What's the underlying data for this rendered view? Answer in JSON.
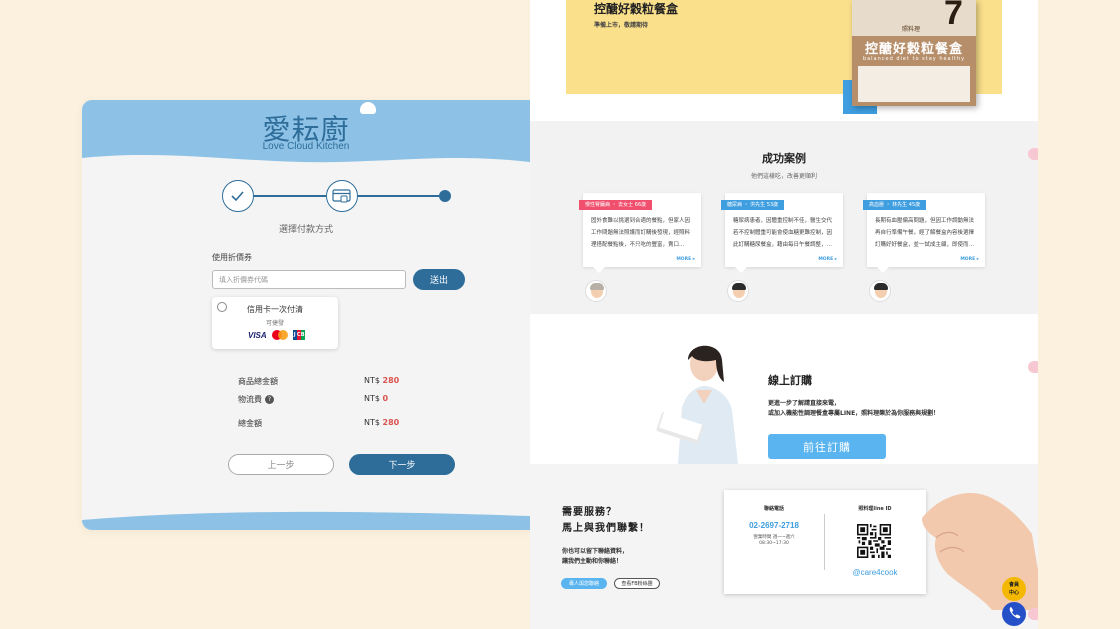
{
  "checkout": {
    "logo_cn": "愛耘廚",
    "logo_en": "Love Cloud Kitchen",
    "step_caption": "選擇付款方式",
    "coupon": {
      "label": "使用折價券",
      "placeholder": "填入折價券代碼",
      "submit": "送出"
    },
    "payment_option": {
      "title": "信用卡一次付清",
      "subtitle": "可捷發",
      "brands": [
        "VISA",
        "MasterCard",
        "JCB"
      ]
    },
    "summary": [
      {
        "label": "商品總金額",
        "currency": "NT$",
        "value": "280"
      },
      {
        "label": "物流費",
        "currency": "NT$",
        "value": "0"
      },
      {
        "label": "總金額",
        "currency": "NT$",
        "value": "280"
      }
    ],
    "prev_button": "上一步",
    "next_button": "下一步",
    "colors": {
      "primary": "#2e6d99",
      "wave": "#8dc2e6",
      "price": "#d9534f"
    }
  },
  "landing": {
    "promo": {
      "title": "控醣好穀粒餐盒",
      "subtitle": "準備上市，敬請期待",
      "box_number": "7",
      "box_brand": "照料理",
      "box_title": "控醣好穀粒餐盒",
      "box_en": "balanced diet to stay healthy"
    },
    "cases": {
      "title": "成功案例",
      "subtitle": "他們這樣吃，改善更順利",
      "more_label": "MORE ▸",
      "items": [
        {
          "tag": "慢性腎臟病 ・ 去女士 66歲",
          "tag_color": "#f0506e",
          "text": "固外食難以挑選到合適的餐點，但家人因工作問題無法照護而訂購後發現，經照料理搭配餐點後，不只吃的豐富，賣口…"
        },
        {
          "tag": "糖尿病 ・ 洪先生 53歲",
          "tag_color": "#3e9ee0",
          "text": "糖尿病患者，因體重控制不佳，醫生交代若不控制體重可能會使血糖更難控制，因此訂購糖尿餐盒，藉由每日午餐調整，…"
        },
        {
          "tag": "高血壓 ・ 林先生 45歲",
          "tag_color": "#3e9ee0",
          "text": "長期有血壓偏高問題，但因工作調動無法再自行準備午餐，經了解餐盒內容後選擇訂購好好餐盒，並一試成主顧，即使而…"
        }
      ]
    },
    "order": {
      "title": "線上訂購",
      "desc_line1": "更進一步了解請直接來電，",
      "desc_line2": "或加入機能性調理餐盒專屬LINE，照料理樂於為你服務與規劃！",
      "button": "前往訂購"
    },
    "contact": {
      "title_line1": "需要服務？",
      "title_line2": "馬上與我們聯繫！",
      "desc_line1": "你也可以留下聯絡資料，",
      "desc_line2": "讓我們主動和你聯絡！",
      "btn_contact": "專人與您聯絡",
      "btn_fb": "查看FB粉絲團",
      "card": {
        "phone_heading": "聯絡電話",
        "phone": "02-2697-2718",
        "hours_line1": "營業時間 週一~週六",
        "hours_line2": "08:30~17:30",
        "line_heading": "照料理line ID",
        "line_id": "@care4cook"
      }
    },
    "floating": {
      "service_line1": "會員",
      "service_line2": "中心"
    }
  }
}
